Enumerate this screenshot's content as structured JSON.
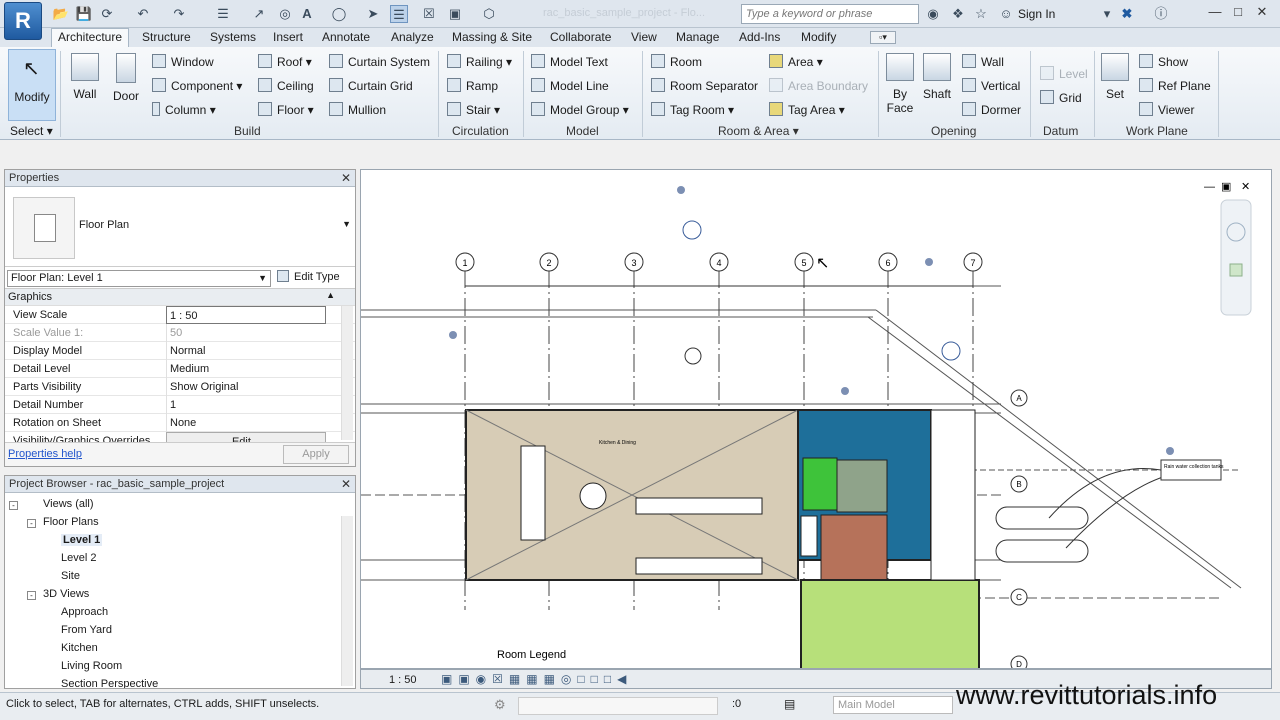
{
  "app": {
    "logo": "R",
    "window_title": "rac_basic_sample_project - Flo...",
    "search_placeholder": "Type a keyword or phrase",
    "sign_in": "Sign In"
  },
  "tabs": [
    "Architecture",
    "Structure",
    "Systems",
    "Insert",
    "Annotate",
    "Analyze",
    "Massing & Site",
    "Collaborate",
    "View",
    "Manage",
    "Add-Ins",
    "Modify"
  ],
  "ribbon": {
    "select": {
      "modify": "Modify",
      "select_label": "Select"
    },
    "build": {
      "label": "Build",
      "wall": "Wall",
      "door": "Door",
      "window": "Window",
      "component": "Component",
      "column": "Column",
      "roof": "Roof",
      "ceiling": "Ceiling",
      "floor": "Floor",
      "curtain_system": "Curtain System",
      "curtain_grid": "Curtain Grid",
      "mullion": "Mullion"
    },
    "circulation": {
      "label": "Circulation",
      "railing": "Railing",
      "ramp": "Ramp",
      "stair": "Stair"
    },
    "model": {
      "label": "Model",
      "model_text": "Model Text",
      "model_line": "Model Line",
      "model_group": "Model Group"
    },
    "room_area": {
      "label": "Room & Area",
      "room": "Room",
      "room_separator": "Room Separator",
      "tag_room": "Tag Room",
      "area": "Area",
      "area_boundary": "Area Boundary",
      "tag_area": "Tag Area"
    },
    "opening": {
      "label": "Opening",
      "by_face_1": "By",
      "by_face_2": "Face",
      "shaft": "Shaft",
      "wall": "Wall",
      "vertical": "Vertical",
      "dormer": "Dormer"
    },
    "datum": {
      "label": "Datum",
      "level": "Level",
      "grid": "Grid"
    },
    "work_plane": {
      "label": "Work Plane",
      "set": "Set",
      "show": "Show",
      "ref_plane": "Ref Plane",
      "viewer": "Viewer"
    }
  },
  "properties": {
    "title": "Properties",
    "type_name": "Floor Plan",
    "instance": "Floor Plan: Level 1",
    "edit_type": "Edit Type",
    "group": "Graphics",
    "rows": [
      {
        "name": "View Scale",
        "value": "1 : 50"
      },
      {
        "name": "Scale Value   1:",
        "value": "50"
      },
      {
        "name": "Display Model",
        "value": "Normal"
      },
      {
        "name": "Detail Level",
        "value": "Medium"
      },
      {
        "name": "Parts Visibility",
        "value": "Show Original"
      },
      {
        "name": "Detail Number",
        "value": "1"
      },
      {
        "name": "Rotation on Sheet",
        "value": "None"
      },
      {
        "name": "Visibility/Graphics Overrides",
        "value": "Edit..."
      }
    ],
    "help": "Properties help",
    "apply": "Apply"
  },
  "browser": {
    "title": "Project Browser - rac_basic_sample_project",
    "items": [
      "Views (all)",
      "Floor Plans",
      "Level 1",
      "Level 2",
      "Site",
      "3D Views",
      "Approach",
      "From Yard",
      "Kitchen",
      "Living Room",
      "Section Perspective"
    ]
  },
  "canvas": {
    "grid_labels": [
      "1",
      "2",
      "3",
      "4",
      "5",
      "6",
      "7"
    ],
    "side_labels": [
      "A",
      "B",
      "C",
      "D"
    ],
    "room_legend": "Room Legend",
    "kitchen_tag": "Kitchen & Dining",
    "annotation": "Rain water collection tanks"
  },
  "view_bar": {
    "scale": "1 : 50"
  },
  "status": {
    "text": "Click to select, TAB for alternates, CTRL adds, SHIFT unselects.",
    "workset": "Main Model",
    "count": ":0"
  },
  "watermark": "www.revittutorials.info",
  "colors": {
    "room_beige": "#d7ccb6",
    "room_blue": "#1e6f9a",
    "room_green": "#3ec33a",
    "room_brown": "#b6725a",
    "room_lightgreen": "#b7e07a",
    "accent": "#1f5aa0"
  }
}
